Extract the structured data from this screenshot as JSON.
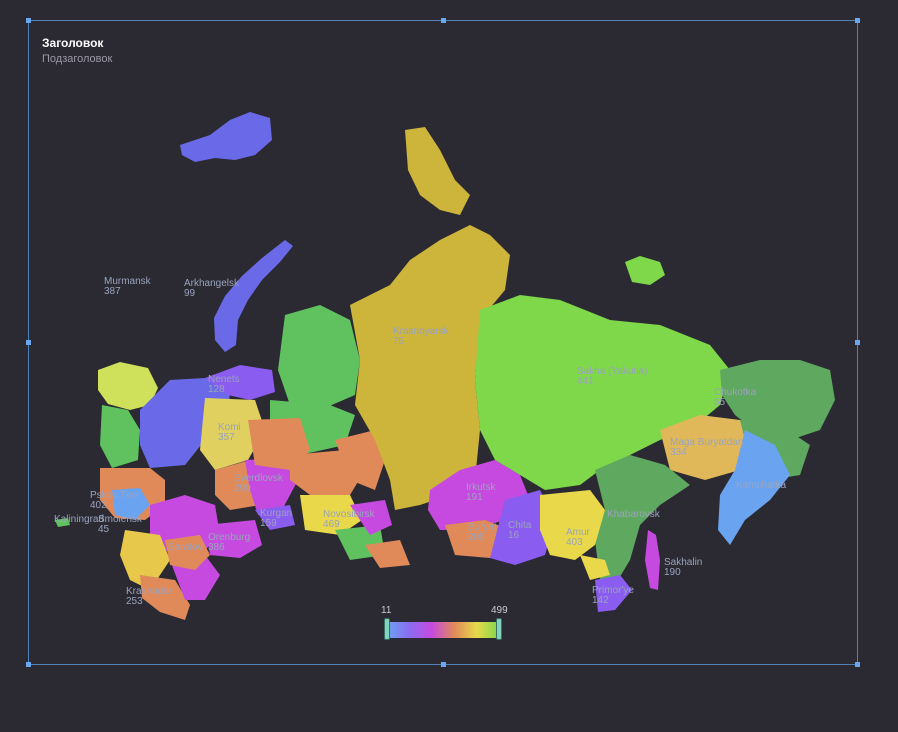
{
  "header": {
    "title": "Заголовок",
    "subtitle": "Подзаголовок"
  },
  "visual_map": {
    "min": "11",
    "max": "499",
    "colors": [
      "#6aa3f0",
      "#8a6cf0",
      "#c64ae0",
      "#e08a5a",
      "#e8d84a",
      "#7ed84a"
    ]
  },
  "regions": [
    {
      "name": "Murmansk",
      "value": "387"
    },
    {
      "name": "Arkhangelsk",
      "value": "99"
    },
    {
      "name": "Nenets",
      "value": "128"
    },
    {
      "name": "Komi",
      "value": "357"
    },
    {
      "name": "Krasnoyarsk",
      "value": "75"
    },
    {
      "name": "Sakha (Yakutia)",
      "value": "441"
    },
    {
      "name": "Maga Buryatdan",
      "value": "334"
    },
    {
      "name": "Kamchatka",
      "value": ""
    },
    {
      "name": "Khabarovsk",
      "value": ""
    },
    {
      "name": "Sakhalin",
      "value": "190"
    },
    {
      "name": "Primor'ye",
      "value": "142"
    },
    {
      "name": "Amur",
      "value": "403"
    },
    {
      "name": "Buryat",
      "value": "205"
    },
    {
      "name": "Irkutsk",
      "value": "191"
    },
    {
      "name": "Novosibirsk",
      "value": "469"
    },
    {
      "name": "Sverdlovsk",
      "value": "290"
    },
    {
      "name": "Saratov",
      "value": ""
    },
    {
      "name": "Orenburg",
      "value": "386"
    },
    {
      "name": "Krasnodar",
      "value": "253"
    },
    {
      "name": "Kaliningrad",
      "value": ""
    },
    {
      "name": "Kurgan",
      "value": "159"
    },
    {
      "name": "Chita",
      "value": "16"
    },
    {
      "name": "Smolensk",
      "value": "45"
    },
    {
      "name": "Pskov Tver",
      "value": "402"
    },
    {
      "name": "Chukotka",
      "value": "55"
    }
  ]
}
